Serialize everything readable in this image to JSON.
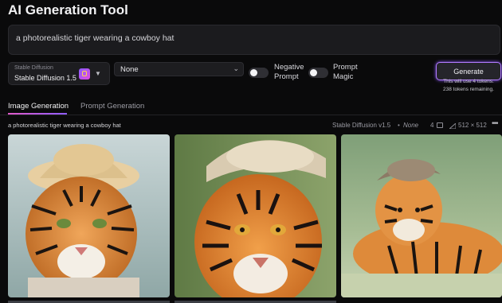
{
  "app": {
    "title": "AI Generation Tool"
  },
  "prompt": {
    "value": "a photorealistic tiger wearing a cowboy hat"
  },
  "model_select": {
    "caption": "Stable Diffusion",
    "value": "Stable Diffusion 1.5"
  },
  "style_select": {
    "value": "None"
  },
  "toggles": [
    {
      "label_line1": "Negative",
      "label_line2": "Prompt",
      "on": false
    },
    {
      "label_line1": "Prompt",
      "label_line2": "Magic",
      "on": false
    }
  ],
  "generate": {
    "label": "Generate",
    "note_line1": "This will use 4 tokens.",
    "note_line2": "238 tokens remaining."
  },
  "tabs": [
    {
      "label": "Image Generation",
      "active": true
    },
    {
      "label": "Prompt Generation",
      "active": false
    }
  ],
  "generation": {
    "prompt": "a photorealistic tiger wearing a cowboy hat",
    "model": "Stable Diffusion v1.5",
    "dot": "•",
    "sampler": "None",
    "count": "4",
    "size": "512 × 512",
    "more": "•••"
  },
  "images": [
    {
      "alt": "tiger wearing a cowboy hat, portrait 1"
    },
    {
      "alt": "tiger wearing a cowboy hat, close-up 2"
    },
    {
      "alt": "tiger wearing a cowboy hat, lying in grass 3"
    }
  ],
  "colors": {
    "accent": "#b27bff",
    "tab_gradient_start": "#e05ac8",
    "tab_gradient_end": "#8f5cff",
    "background": "#0a0a0b"
  }
}
